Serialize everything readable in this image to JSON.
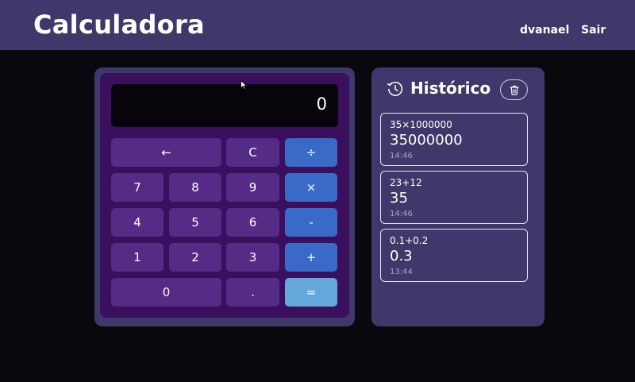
{
  "header": {
    "title": "Calculadora",
    "user": "dvanael",
    "logout": "Sair"
  },
  "calculator": {
    "display": "0",
    "keys": {
      "backspace": "←",
      "clear": "C",
      "divide": "÷",
      "seven": "7",
      "eight": "8",
      "nine": "9",
      "multiply": "×",
      "four": "4",
      "five": "5",
      "six": "6",
      "subtract": "-",
      "one": "1",
      "two": "2",
      "three": "3",
      "add": "+",
      "zero": "0",
      "decimal": ".",
      "equals": "="
    },
    "colors": {
      "number_key": "#542c86",
      "operator_key": "#3a6ac8",
      "equals_key": "#65a8dc"
    }
  },
  "history": {
    "title": "Histórico",
    "icons": {
      "title_icon": "clock-icon",
      "clear_icon": "trash-icon"
    },
    "entries": [
      {
        "expression": "35×1000000",
        "result": "35000000",
        "time": "14:46"
      },
      {
        "expression": "23+12",
        "result": "35",
        "time": "14:46"
      },
      {
        "expression": "0.1+0.2",
        "result": "0.3",
        "time": "13:44"
      }
    ]
  }
}
